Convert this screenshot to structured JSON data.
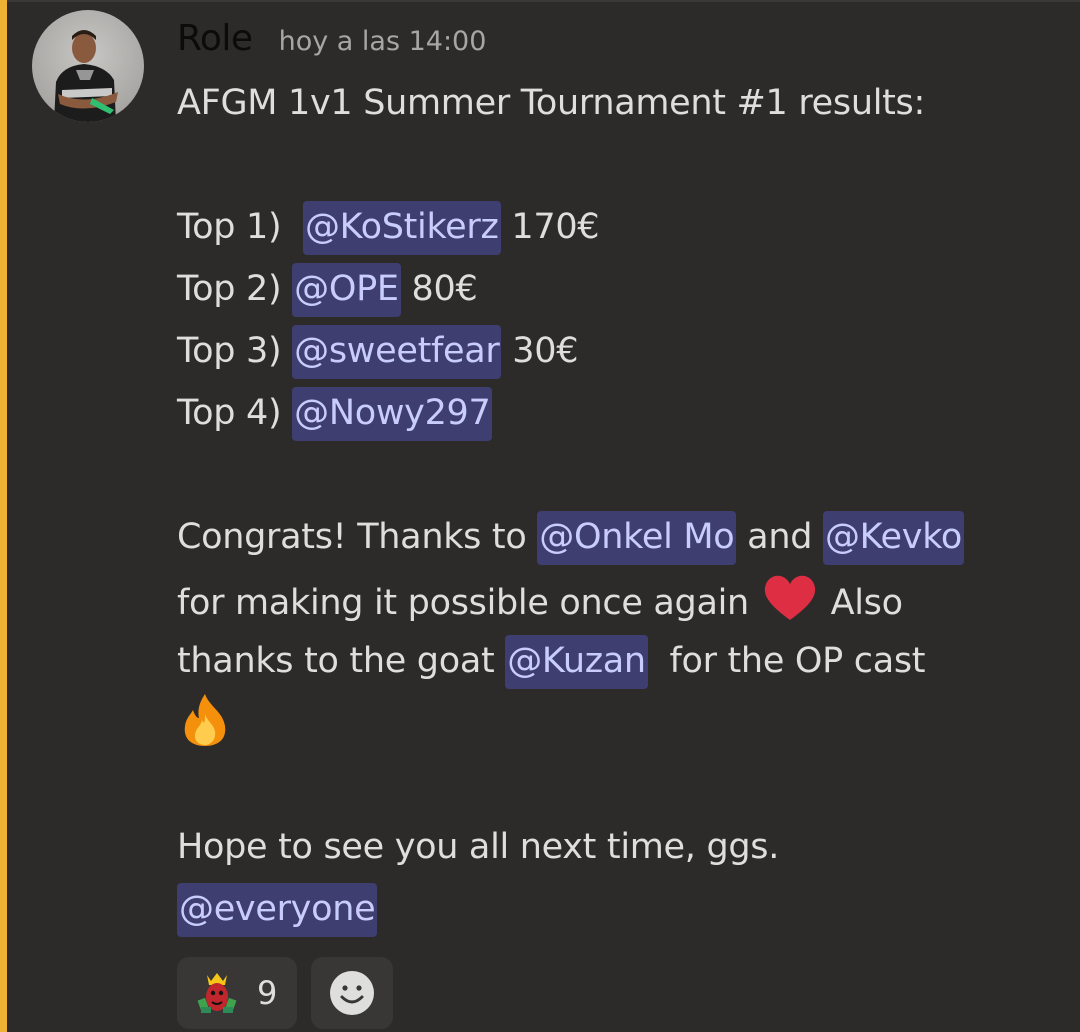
{
  "message": {
    "author": "Role",
    "timestamp": "hoy a las 14:00",
    "accent_color": "#f0b232",
    "lines": {
      "title": "AFGM 1v1 Summer Tournament #1 results:",
      "top1_prefix": "Top 1)  ",
      "top1_mention": "@KoStikerz",
      "top1_prize": " 170€",
      "top2_prefix": "Top 2) ",
      "top2_mention": "@OPE",
      "top2_prize": " 80€",
      "top3_prefix": "Top 3) ",
      "top3_mention": "@sweetfear",
      "top3_prize": " 30€",
      "top4_prefix": "Top 4) ",
      "top4_mention": "@Nowy297",
      "congrats_text": "Congrats! Thanks to ",
      "congrats_mention1": "@Onkel Mo",
      "congrats_and": " and ",
      "congrats_mention2": "@Kevko",
      "making_text": "for making it possible once again ",
      "also_text": " Also",
      "thanks_text": "thanks to the goat ",
      "thanks_mention": "@Kuzan",
      "cast_text": "  for the OP cast",
      "hope_text": "Hope to see you all next time, ggs.",
      "everyone_mention": "@everyone"
    },
    "emojis": {
      "heart": "heart-emoji",
      "fire": "fire-emoji"
    }
  },
  "reactions": [
    {
      "icon": "custom-emote-icon",
      "count": "9"
    },
    {
      "icon": "add-reaction-icon"
    }
  ],
  "colors": {
    "mention_bg": "#3e3f70",
    "mention_text": "#c9cdfb",
    "text": "#dededc"
  }
}
